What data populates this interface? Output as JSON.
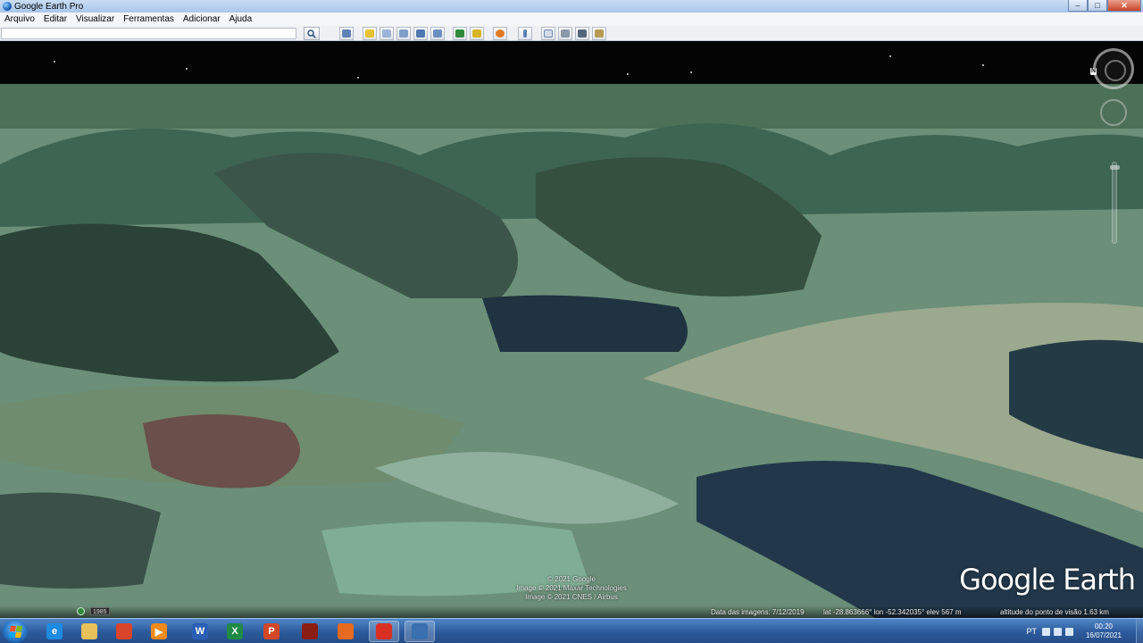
{
  "window": {
    "title": "Google Earth Pro",
    "minimize": "–",
    "maximize": "□",
    "close": "✕"
  },
  "menu": [
    "Arquivo",
    "Editar",
    "Visualizar",
    "Ferramentas",
    "Adicionar",
    "Ajuda"
  ],
  "toolbar": {
    "search_value": "",
    "icons": [
      "search-icon",
      "sidebar-icon",
      "placemark-icon",
      "polygon-icon",
      "path-icon",
      "image-overlay-icon",
      "tour-icon",
      "historical-imagery-icon",
      "sunlight-icon",
      "planets-icon",
      "ruler-icon",
      "email-icon",
      "print-icon",
      "save-image-icon",
      "maps-icon"
    ]
  },
  "viewport": {
    "navigation_north": "N",
    "logo": "Google Earth",
    "credits": [
      "© 2021 Google",
      "Image © 2021 Maxar Technologies",
      "Image © 2021 CNES / Airbus"
    ],
    "history_year": "1985",
    "status": {
      "imagery_date": "Data das imagens: 7/12/2019",
      "coordinates": "lat  -28.863666°  lon  -52.342035°  elev  567 m",
      "eye_alt": "altitude do ponto de visão   1.63 km"
    }
  },
  "taskbar": {
    "apps": [
      {
        "name": "internet-explorer",
        "label": "e",
        "color": "#1e8ae0"
      },
      {
        "name": "file-explorer",
        "label": "",
        "color": "#e8c15a"
      },
      {
        "name": "app-red",
        "label": "",
        "color": "#d9442a"
      },
      {
        "name": "media-player",
        "label": "▶",
        "color": "#f08a1c"
      },
      {
        "name": "word",
        "label": "W",
        "color": "#2b5fb4"
      },
      {
        "name": "excel",
        "label": "X",
        "color": "#1f8a45"
      },
      {
        "name": "powerpoint",
        "label": "P",
        "color": "#d24726"
      },
      {
        "name": "app-dark",
        "label": "",
        "color": "#8a1e12"
      },
      {
        "name": "firefox",
        "label": "",
        "color": "#e66a1f"
      },
      {
        "name": "chrome",
        "label": "",
        "color": "#d93025"
      },
      {
        "name": "google-earth-pro",
        "label": "",
        "color": "#3a6fb0"
      }
    ],
    "language": "PT",
    "time": "00:20",
    "date": "16/07/2021"
  }
}
